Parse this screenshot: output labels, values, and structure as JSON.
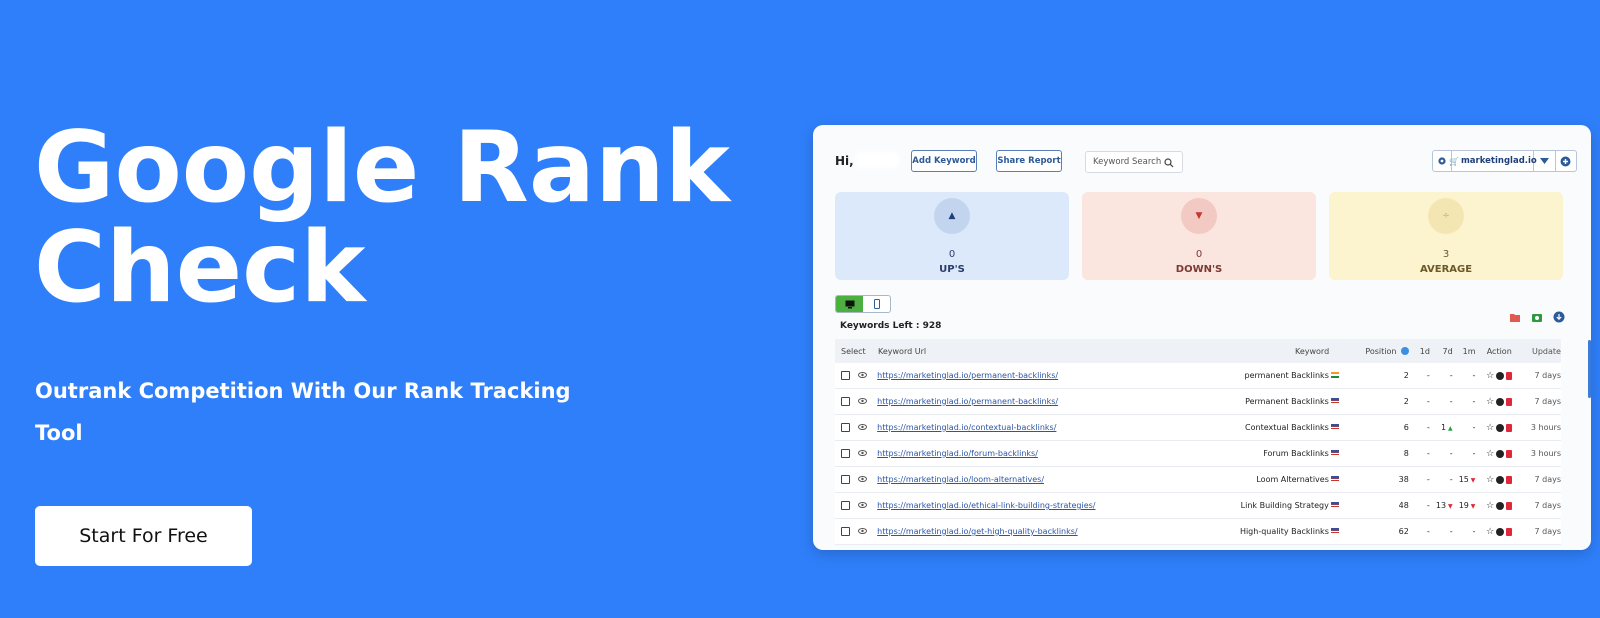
{
  "hero": {
    "title_line1": "Google Rank",
    "title_line2": "Check",
    "subtitle": "Outrank Competition With Our Rank Tracking Tool",
    "cta_label": "Start For Free"
  },
  "app": {
    "greeting": "Hi,",
    "add_keyword_label": "Add Keyword",
    "share_report_label": "Share Report",
    "search_placeholder": "Keyword Search",
    "site_name": "marketinglad.io",
    "cards": [
      {
        "value": "0",
        "label": "UP'S",
        "icon": "triangle-up-icon",
        "color": "#dce9fb",
        "text": "#2a3e6a"
      },
      {
        "value": "0",
        "label": "DOWN'S",
        "icon": "triangle-down-icon",
        "color": "#fbe5df",
        "text": "#7a3a33"
      },
      {
        "value": "3",
        "label": "AVERAGE",
        "icon": "divide-icon",
        "color": "#fcf3cf",
        "text": "#6a5a2a"
      }
    ],
    "keywords_left": "Keywords Left : 928",
    "columns": {
      "select": "Select",
      "url": "Keyword Url",
      "keyword": "Keyword",
      "position": "Position",
      "d1": "1d",
      "d7": "7d",
      "m1": "1m",
      "action": "Action",
      "update": "Update"
    },
    "rows": [
      {
        "url": "https://marketinglad.io/permanent-backlinks/",
        "keyword": "permanent Backlinks",
        "flag": "in",
        "position": "2",
        "d1": "-",
        "d7": "-",
        "m1": "-",
        "d7_dir": "",
        "m1_dir": "",
        "update": "7 days"
      },
      {
        "url": "https://marketinglad.io/permanent-backlinks/",
        "keyword": "Permanent Backlinks",
        "flag": "us",
        "position": "2",
        "d1": "-",
        "d7": "-",
        "m1": "-",
        "d7_dir": "",
        "m1_dir": "",
        "update": "7 days"
      },
      {
        "url": "https://marketinglad.io/contextual-backlinks/",
        "keyword": "Contextual Backlinks",
        "flag": "us",
        "position": "6",
        "d1": "-",
        "d7": "1",
        "m1": "-",
        "d7_dir": "up",
        "m1_dir": "",
        "update": "3 hours"
      },
      {
        "url": "https://marketinglad.io/forum-backlinks/",
        "keyword": "Forum Backlinks",
        "flag": "us",
        "position": "8",
        "d1": "-",
        "d7": "-",
        "m1": "-",
        "d7_dir": "",
        "m1_dir": "",
        "update": "3 hours"
      },
      {
        "url": "https://marketinglad.io/loom-alternatives/",
        "keyword": "Loom Alternatives",
        "flag": "us",
        "position": "38",
        "d1": "-",
        "d7": "-",
        "m1": "15",
        "d7_dir": "",
        "m1_dir": "down",
        "update": "7 days"
      },
      {
        "url": "https://marketinglad.io/ethical-link-building-strategies/",
        "keyword": "Link Building Strategy",
        "flag": "us",
        "position": "48",
        "d1": "-",
        "d7": "13",
        "m1": "19",
        "d7_dir": "down",
        "m1_dir": "down",
        "update": "7 days"
      },
      {
        "url": "https://marketinglad.io/get-high-quality-backlinks/",
        "keyword": "High-quality Backlinks",
        "flag": "us",
        "position": "62",
        "d1": "-",
        "d7": "-",
        "m1": "-",
        "d7_dir": "",
        "m1_dir": "",
        "update": "7 days"
      }
    ]
  }
}
